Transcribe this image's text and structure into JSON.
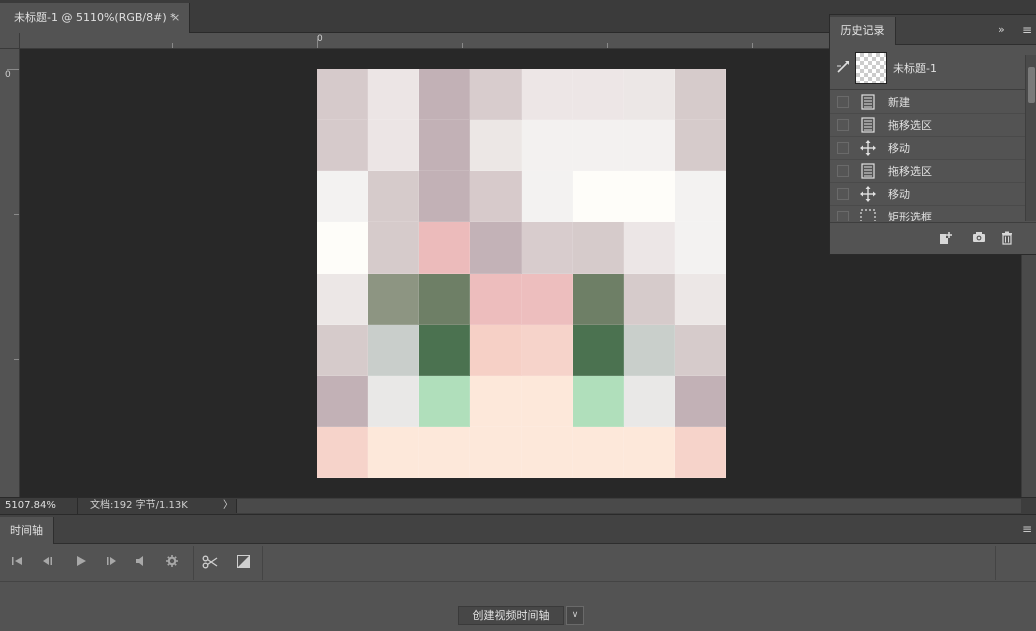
{
  "document_tab": {
    "title": "未标题-1 @ 5110%(RGB/8#) *",
    "close_glyph": "×"
  },
  "rulers": {
    "top_origin_label": "0",
    "left_origin_label": "0"
  },
  "canvas": {
    "workspace_color": "#282828",
    "pixel_colors": [
      [
        "#d6cacb",
        "#ece5e5",
        "#c2b1b6",
        "#d8cccd",
        "#ede6e6",
        "#ede6e6",
        "#ece7e6",
        "#d6cbcb"
      ],
      [
        "#d6cacb",
        "#ece5e5",
        "#c2b1b6",
        "#ece7e5",
        "#f3f1f0",
        "#f3f1f0",
        "#f3f1f0",
        "#d6cbcb"
      ],
      [
        "#f3f2f1",
        "#d6cbcb",
        "#c2b1b6",
        "#d7cacb",
        "#f3f2f1",
        "#fefdf9",
        "#fefdf9",
        "#f3f2f1"
      ],
      [
        "#fefdf9",
        "#d6cbcb",
        "#ecbbbb",
        "#c3b2b7",
        "#d8cccd",
        "#d6cbcb",
        "#ece6e6",
        "#f3f2f1"
      ],
      [
        "#ece7e6",
        "#8d9582",
        "#6e7f66",
        "#edbdbd",
        "#edbebe",
        "#6e7f66",
        "#d6cbcb",
        "#ece7e6"
      ],
      [
        "#d6cbcb",
        "#c9cecb",
        "#4b7250",
        "#f6d0c6",
        "#f6d3ca",
        "#4b7250",
        "#c9cfcb",
        "#d6cbcb"
      ],
      [
        "#c2b1b6",
        "#e9e8e7",
        "#b0dfbb",
        "#fde8da",
        "#fde8da",
        "#b0dfbb",
        "#e9e8e7",
        "#c2b1b6"
      ],
      [
        "#f6d3ca",
        "#fde8da",
        "#fde8da",
        "#fde8da",
        "#fde8da",
        "#fde8da",
        "#fde8da",
        "#f6d3ca"
      ]
    ]
  },
  "statusbar": {
    "zoom": "5107.84%",
    "doc_info": "文档:192 字节/1.13K",
    "arrow": "〉"
  },
  "timeline": {
    "tab_label": "时间轴",
    "menu_icon": "≡",
    "create_button": "创建视频时间轴",
    "dropdown_icon": "∨"
  },
  "history": {
    "tab_label": "历史记录",
    "expand_icon": "»",
    "menu_icon": "≡",
    "snapshot_name": "未标题-1",
    "items": [
      {
        "label": "新建",
        "icon": "document"
      },
      {
        "label": "拖移选区",
        "icon": "document"
      },
      {
        "label": "移动",
        "icon": "move"
      },
      {
        "label": "拖移选区",
        "icon": "document"
      },
      {
        "label": "移动",
        "icon": "move"
      },
      {
        "label": "矩形选框",
        "icon": "marquee"
      }
    ]
  },
  "colors": {
    "panel_bg": "#535353",
    "tabbar_bg": "#3b3b3b",
    "text": "#d6d6d6"
  }
}
